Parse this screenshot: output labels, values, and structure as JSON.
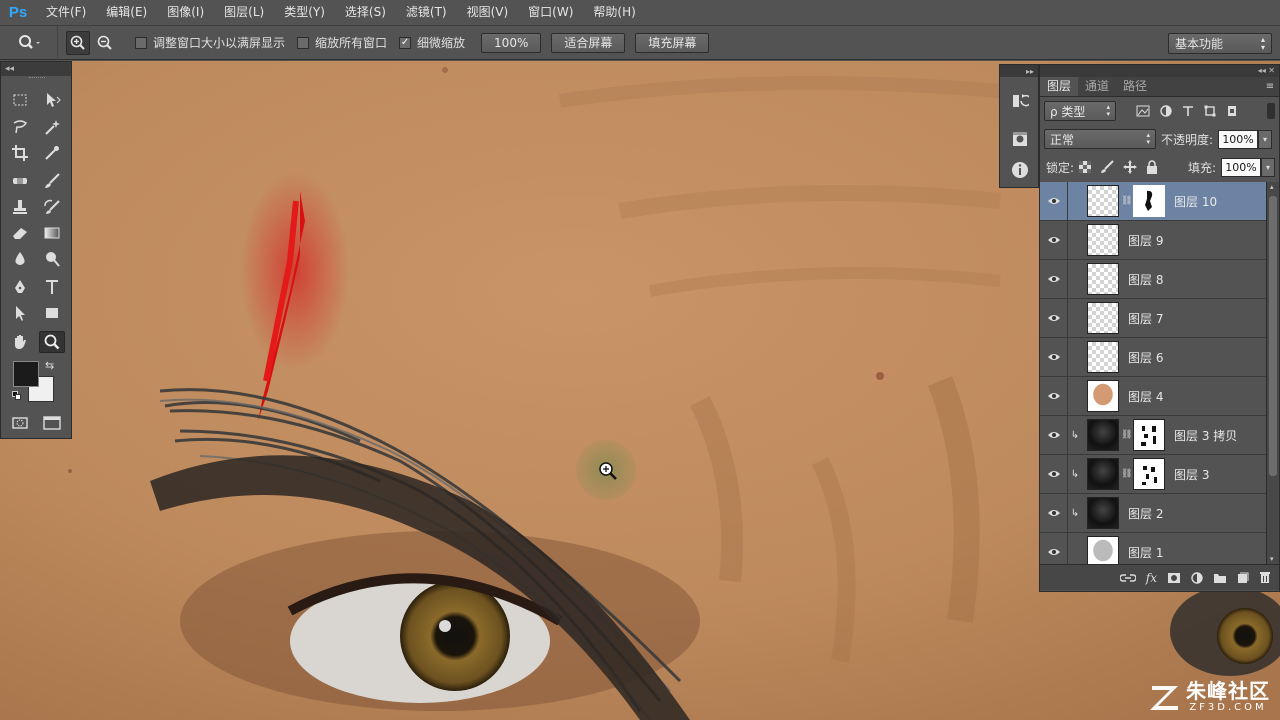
{
  "app": {
    "logo": "Ps",
    "accent": "#31a8ff"
  },
  "menu": [
    "文件(F)",
    "编辑(E)",
    "图像(I)",
    "图层(L)",
    "类型(Y)",
    "选择(S)",
    "滤镜(T)",
    "视图(V)",
    "窗口(W)",
    "帮助(H)"
  ],
  "options": {
    "tool_icon": "zoom-icon",
    "zoom_in_icon": "zoom-in-icon",
    "zoom_out_icon": "zoom-out-icon",
    "resize_windows_label": "调整窗口大小以满屏显示",
    "resize_windows_checked": false,
    "zoom_all_label": "缩放所有窗口",
    "zoom_all_checked": false,
    "scrubby_zoom_label": "细微缩放",
    "scrubby_zoom_checked": true,
    "percent_button": "100%",
    "fit_screen_button": "适合屏幕",
    "fill_screen_button": "填充屏幕",
    "workspace": "基本功能"
  },
  "layers_panel": {
    "tabs": [
      "图层",
      "通道",
      "路径"
    ],
    "active_tab": "图层",
    "filter_kind": "ρ 类型",
    "blend_mode": "正常",
    "opacity_label": "不透明度:",
    "opacity_value": "100%",
    "lock_label": "锁定:",
    "fill_label": "填充:",
    "fill_value": "100%",
    "layers": [
      {
        "name": "图层 10",
        "thumb": "transparent",
        "mask": true,
        "clipped": false,
        "selected": true
      },
      {
        "name": "图层 9",
        "thumb": "transparent",
        "mask": false,
        "clipped": false,
        "selected": false
      },
      {
        "name": "图层 8",
        "thumb": "transparent",
        "mask": false,
        "clipped": false,
        "selected": false
      },
      {
        "name": "图层 7",
        "thumb": "transparent",
        "mask": false,
        "clipped": false,
        "selected": false
      },
      {
        "name": "图层 6",
        "thumb": "transparent",
        "mask": false,
        "clipped": false,
        "selected": false
      },
      {
        "name": "图层 4",
        "thumb": "skin",
        "mask": false,
        "clipped": false,
        "selected": false
      },
      {
        "name": "图层 3 拷贝",
        "thumb": "dark",
        "mask": true,
        "clipped": true,
        "selected": false
      },
      {
        "name": "图层 3",
        "thumb": "dark",
        "mask": true,
        "clipped": true,
        "selected": false
      },
      {
        "name": "图层 2",
        "thumb": "dark",
        "mask": false,
        "clipped": true,
        "selected": false
      },
      {
        "name": "图层 1",
        "thumb": "grey",
        "mask": false,
        "clipped": false,
        "selected": false
      }
    ]
  },
  "watermark": {
    "title": "朱峰社区",
    "url": "ZF3D.COM"
  },
  "colors": {
    "selected_layer": "#6d83a3",
    "skin": "#c18e61",
    "blood": "#d01515"
  }
}
